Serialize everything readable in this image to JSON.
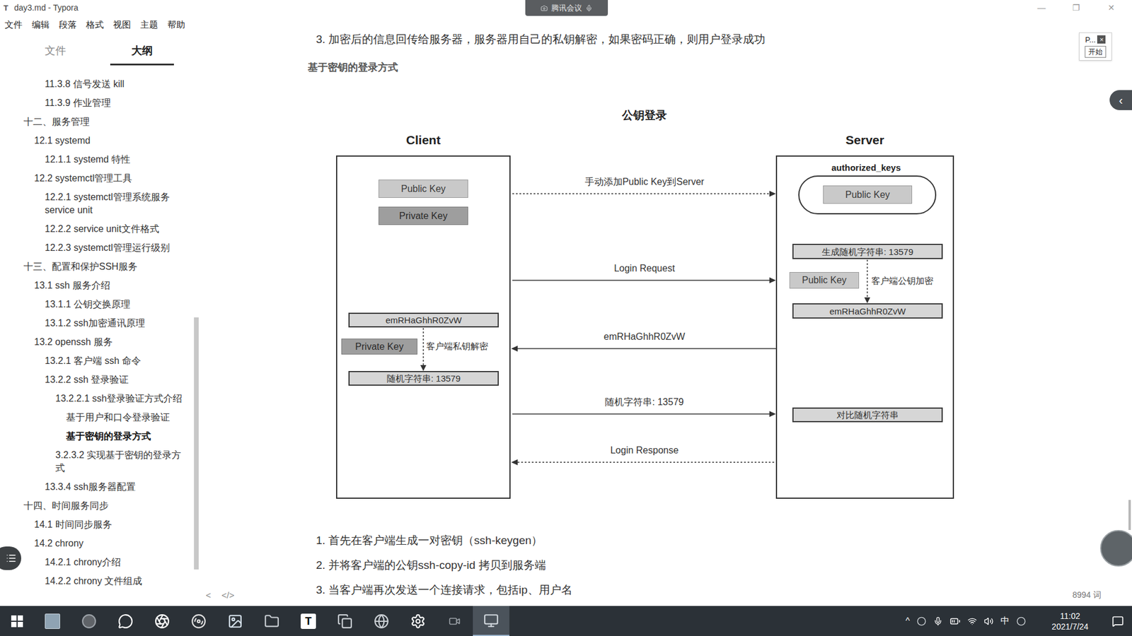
{
  "window": {
    "title": "day3.md - Typora",
    "icon": "T",
    "controls": [
      "—",
      "❐",
      "✕"
    ]
  },
  "meeting_tab": {
    "label": "腾讯会议"
  },
  "menu": [
    "文件",
    "编辑",
    "段落",
    "格式",
    "视图",
    "主题",
    "帮助"
  ],
  "sidebar": {
    "tabs": [
      {
        "label": "文件",
        "selected": false
      },
      {
        "label": "大纲",
        "selected": true
      }
    ],
    "items": [
      {
        "label": "11.3.8 信号发送 kill",
        "depth": 3,
        "selected": false
      },
      {
        "label": "11.3.9 作业管理",
        "depth": 3,
        "selected": false
      },
      {
        "label": "十二、服务管理",
        "depth": 1,
        "selected": false
      },
      {
        "label": "12.1 systemd",
        "depth": 2,
        "selected": false
      },
      {
        "label": "12.1.1 systemd 特性",
        "depth": 3,
        "selected": false
      },
      {
        "label": "12.2 systemctl管理工具",
        "depth": 2,
        "selected": false
      },
      {
        "label": "12.2.1 systemctl管理系统服务 service unit",
        "depth": 3,
        "selected": false
      },
      {
        "label": "12.2.2 service unit文件格式",
        "depth": 3,
        "selected": false
      },
      {
        "label": "12.2.3 systemctl管理运行级别",
        "depth": 3,
        "selected": false
      },
      {
        "label": "十三、配置和保护SSH服务",
        "depth": 1,
        "selected": false
      },
      {
        "label": "13.1 ssh 服务介绍",
        "depth": 2,
        "selected": false
      },
      {
        "label": "13.1.1 公钥交换原理",
        "depth": 3,
        "selected": false
      },
      {
        "label": "13.1.2 ssh加密通讯原理",
        "depth": 3,
        "selected": false
      },
      {
        "label": "13.2 openssh 服务",
        "depth": 2,
        "selected": false
      },
      {
        "label": "13.2.1 客户端 ssh 命令",
        "depth": 3,
        "selected": false
      },
      {
        "label": "13.2.2 ssh 登录验证",
        "depth": 3,
        "selected": false
      },
      {
        "label": "13.2.2.1 ssh登录验证方式介绍",
        "depth": 4,
        "selected": false
      },
      {
        "label": "基于用户和口令登录验证",
        "depth": 5,
        "selected": false
      },
      {
        "label": "基于密钥的登录方式",
        "depth": 5,
        "selected": true
      },
      {
        "label": "3.2.3.2 实现基于密钥的登录方式",
        "depth": 4,
        "selected": false
      },
      {
        "label": "13.3.4 ssh服务器配置",
        "depth": 3,
        "selected": false
      },
      {
        "label": "十四、时间服务同步",
        "depth": 1,
        "selected": false
      },
      {
        "label": "14.1 时间同步服务",
        "depth": 2,
        "selected": false
      },
      {
        "label": "14.2 chrony",
        "depth": 2,
        "selected": false
      },
      {
        "label": "14.2.1 chrony介绍",
        "depth": 3,
        "selected": false
      },
      {
        "label": "14.2.2 chrony 文件组成",
        "depth": 3,
        "selected": false
      }
    ]
  },
  "document": {
    "intro": "3. 加密后的信息回传给服务器，服务器用自己的私钥解密，如果密码正确，则用户登录成功",
    "heading": "基于密钥的登录方式",
    "diagram": {
      "title": "公钥登录",
      "client": "Client",
      "server": "Server",
      "store": "authorized_keys",
      "nodes": [
        {
          "text": "Public Key",
          "kind": "key"
        },
        {
          "text": "Private Key",
          "kind": "private"
        },
        {
          "text": "Public Key",
          "kind": "key"
        },
        {
          "text": "生成随机字符串: 13579",
          "kind": "step"
        },
        {
          "text": "Public Key",
          "kind": "key"
        },
        {
          "text": "emRHaGhhR0ZvW",
          "kind": "step"
        },
        {
          "text": "emRHaGhhR0ZvW",
          "kind": "step"
        },
        {
          "text": "Private Key",
          "kind": "private"
        },
        {
          "text": "随机字符串: 13579",
          "kind": "step"
        },
        {
          "text": "对比随机字符串",
          "kind": "step"
        }
      ],
      "notes": [
        "客户端公钥加密",
        "客户端私钥解密"
      ],
      "messages": [
        {
          "label": "手动添加Public Key到Server",
          "direction": "right",
          "dashed": true
        },
        {
          "label": "Login Request",
          "direction": "right",
          "dashed": false
        },
        {
          "label": "emRHaGhhR0ZvW",
          "direction": "left",
          "dashed": false
        },
        {
          "label": "随机字符串: 13579",
          "direction": "right",
          "dashed": false
        },
        {
          "label": "Login Response",
          "direction": "left",
          "dashed": true
        }
      ]
    },
    "steps": [
      "1. 首先在客户端生成一对密钥（ssh-keygen）",
      "2. 并将客户端的公钥ssh-copy-id 拷贝到服务端",
      "3. 当客户端再次发送一个连接请求，包括ip、用户名"
    ]
  },
  "footer": {
    "back": "<",
    "source": "</>",
    "word_count": "8994 词"
  },
  "floating_widget": {
    "label": "P...",
    "close": "×",
    "button": "开始"
  },
  "side_toggle": "‹",
  "taskbar": {
    "apps": [
      {
        "kind": "photo",
        "glyph": "",
        "selected": false
      },
      {
        "kind": "circle",
        "glyph": "",
        "selected": false
      },
      {
        "kind": "chat",
        "glyph": "",
        "selected": false
      },
      {
        "kind": "aperture",
        "glyph": "",
        "selected": false
      },
      {
        "kind": "swirl",
        "glyph": "",
        "selected": false
      },
      {
        "kind": "image",
        "glyph": "",
        "selected": false
      },
      {
        "kind": "folder",
        "glyph": "",
        "selected": false
      },
      {
        "kind": "typora",
        "glyph": "T",
        "selected": false
      },
      {
        "kind": "stack",
        "glyph": "",
        "selected": false
      },
      {
        "kind": "globe",
        "glyph": "",
        "selected": false
      },
      {
        "kind": "gear",
        "glyph": "",
        "selected": false
      },
      {
        "kind": "camera",
        "glyph": "",
        "selected": false
      },
      {
        "kind": "meeting",
        "glyph": "",
        "selected": true
      }
    ],
    "tray": {
      "expand": "^",
      "ime": "中",
      "time": "11:02",
      "date": "2021/7/24"
    }
  }
}
